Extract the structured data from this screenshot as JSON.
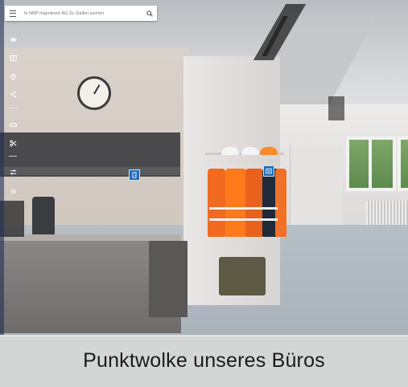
{
  "search": {
    "placeholder": "In NRP Ingenieure AG St. Gallen suchen"
  },
  "toolbar": {
    "items": [
      {
        "icon": "eye-icon"
      },
      {
        "icon": "floorplan-icon"
      },
      {
        "icon": "location-pin-icon"
      },
      {
        "icon": "share-icon"
      },
      {
        "icon": "ruler-icon"
      },
      {
        "icon": "scissors-icon"
      },
      {
        "icon": "sliders-icon"
      },
      {
        "icon": "settings-gear-icon"
      }
    ]
  },
  "hotspots": [
    {
      "icon": "door-icon"
    },
    {
      "icon": "info-panel-icon"
    }
  ],
  "caption": {
    "text": "Punktwolke unseres Büros"
  },
  "colors": {
    "hotspot": "#1f6fb8",
    "caption_bg": "#e4e4e2"
  }
}
